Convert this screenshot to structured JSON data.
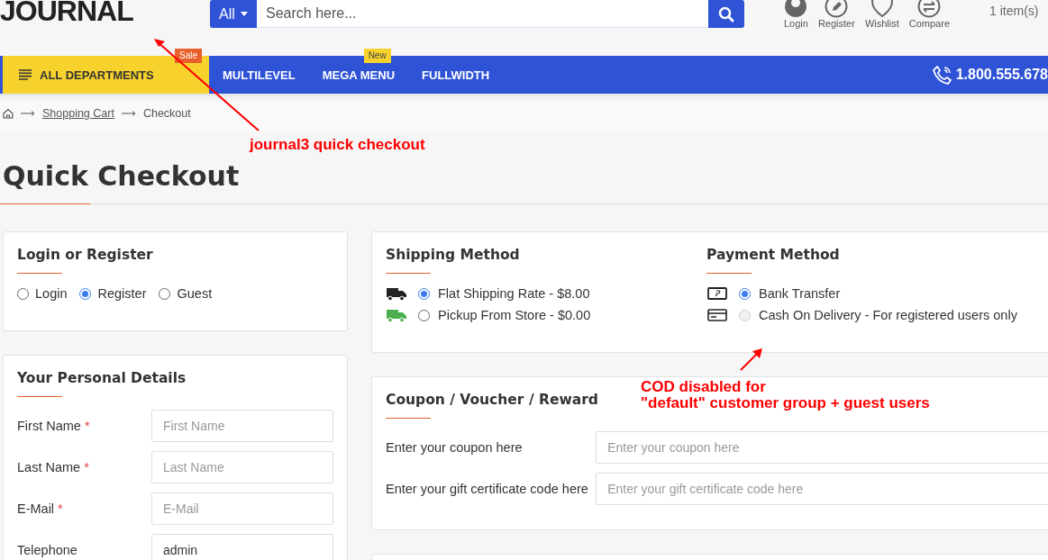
{
  "header": {
    "logo": "JOURNAL",
    "search": {
      "category": "All",
      "placeholder": "Search here..."
    },
    "account_links": [
      {
        "label": "Login",
        "kind": "user"
      },
      {
        "label": "Register",
        "kind": "pencil"
      },
      {
        "label": "Wishlist",
        "kind": "heart"
      },
      {
        "label": "Compare",
        "kind": "swap"
      }
    ],
    "cart": "1 item(s)"
  },
  "nav": {
    "departments": {
      "label": "ALL DEPARTMENTS",
      "badge": "Sale"
    },
    "items": [
      {
        "label": "MULTILEVEL"
      },
      {
        "label": "MEGA MENU",
        "badge": "New"
      },
      {
        "label": "FULLWIDTH"
      }
    ],
    "phone": "1.800.555.678"
  },
  "breadcrumb": [
    "Shopping Cart",
    "Checkout"
  ],
  "page_title": "Quick Checkout",
  "login_section": {
    "title": "Login or Register",
    "options": [
      {
        "label": "Login",
        "selected": false
      },
      {
        "label": "Register",
        "selected": true
      },
      {
        "label": "Guest",
        "selected": false
      }
    ]
  },
  "personal_details": {
    "title": "Your Personal Details",
    "fields": [
      {
        "label": "First Name",
        "required_mark": "*",
        "placeholder": "First Name"
      },
      {
        "label": "Last Name",
        "required_mark": "*",
        "placeholder": "Last Name"
      },
      {
        "label": "E-Mail",
        "required_mark": "*",
        "placeholder": "E-Mail"
      },
      {
        "label": "Telephone",
        "value": "admin"
      }
    ]
  },
  "shipping": {
    "title": "Shipping Method",
    "options": [
      {
        "label": "Flat Shipping Rate - $8.00",
        "selected": true,
        "color": "#222222"
      },
      {
        "label": "Pickup From Store - $0.00",
        "selected": false,
        "color": "#4caf50"
      }
    ]
  },
  "payment": {
    "title": "Payment Method",
    "options": [
      {
        "label": "Bank Transfer",
        "selected": true,
        "disabled": false,
        "kind": "bank"
      },
      {
        "label": "Cash On Delivery - For registered users only",
        "selected": false,
        "disabled": true,
        "kind": "card"
      }
    ]
  },
  "coupon": {
    "title": "Coupon / Voucher / Reward",
    "fields": [
      {
        "label": "Enter your coupon here",
        "placeholder": "Enter your coupon here"
      },
      {
        "label": "Enter your gift certificate code here",
        "placeholder": "Enter your gift certificate code here"
      }
    ]
  },
  "annotations": [
    {
      "lines": [
        "journal3 quick checkout"
      ]
    },
    {
      "lines": [
        "COD disabled for",
        "\"default\" customer group + guest users"
      ]
    }
  ]
}
